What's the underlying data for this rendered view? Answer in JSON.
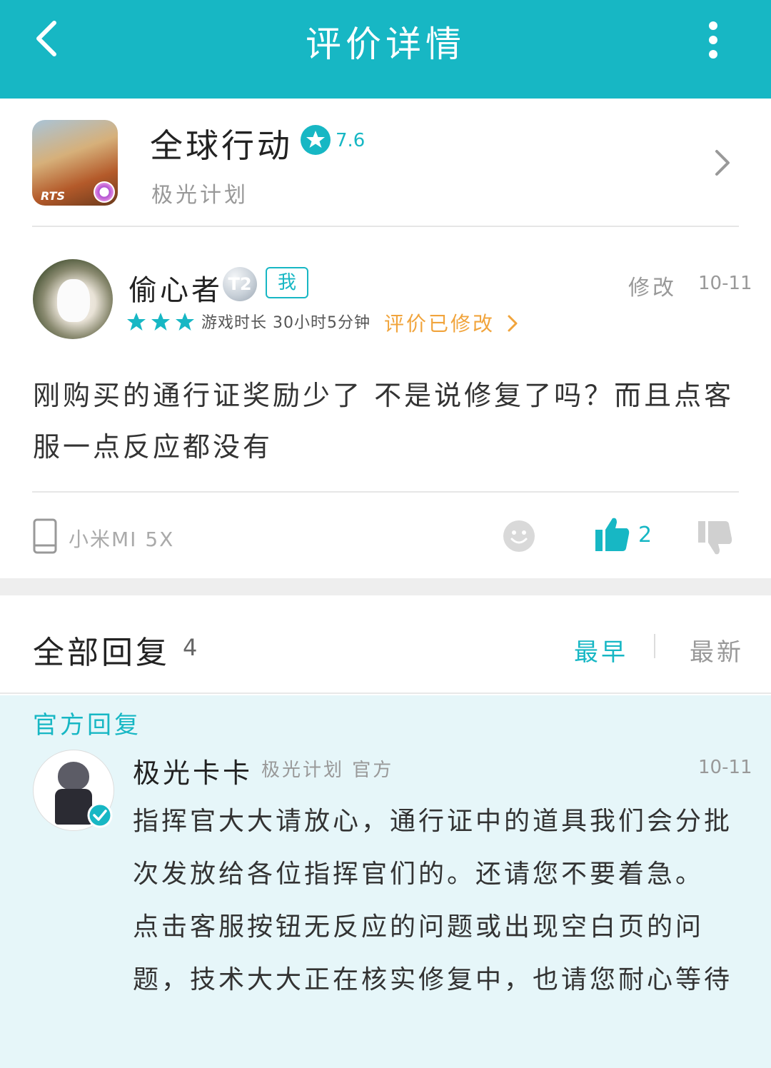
{
  "topbar": {
    "title": "评价详情"
  },
  "game": {
    "name": "全球行动",
    "score": "7.6",
    "developer": "极光计划",
    "icon_text": "RTS"
  },
  "review": {
    "user_name": "偷心者",
    "level_badge": "T2",
    "me_tag": "我",
    "edit_label": "修改",
    "date": "10-11",
    "rating_stars": 3,
    "playtime": "游戏时长 30小时5分钟",
    "modified_link": "评价已修改",
    "text": "刚购买的通行证奖励少了 不是说修复了吗？而且点客服一点反应都没有",
    "device": "小米MI 5X",
    "like_count": "2"
  },
  "replies": {
    "title": "全部回复",
    "count": "4",
    "sort_earliest": "最早",
    "sort_latest": "最新"
  },
  "official_reply": {
    "section_label": "官方回复",
    "name": "极光卡卡",
    "org": "极光计划 官方",
    "date": "10-11",
    "text": "指挥官大大请放心，通行证中的道具我们会分批次发放给各位指挥官们的。还请您不要着急。\n点击客服按钮无反应的问题或出现空白页的问题，技术大大正在核实修复中，也请您耐心等待"
  },
  "colors": {
    "accent": "#17b7c4",
    "orange": "#f1a43c",
    "official_bg": "#e6f6f9"
  }
}
